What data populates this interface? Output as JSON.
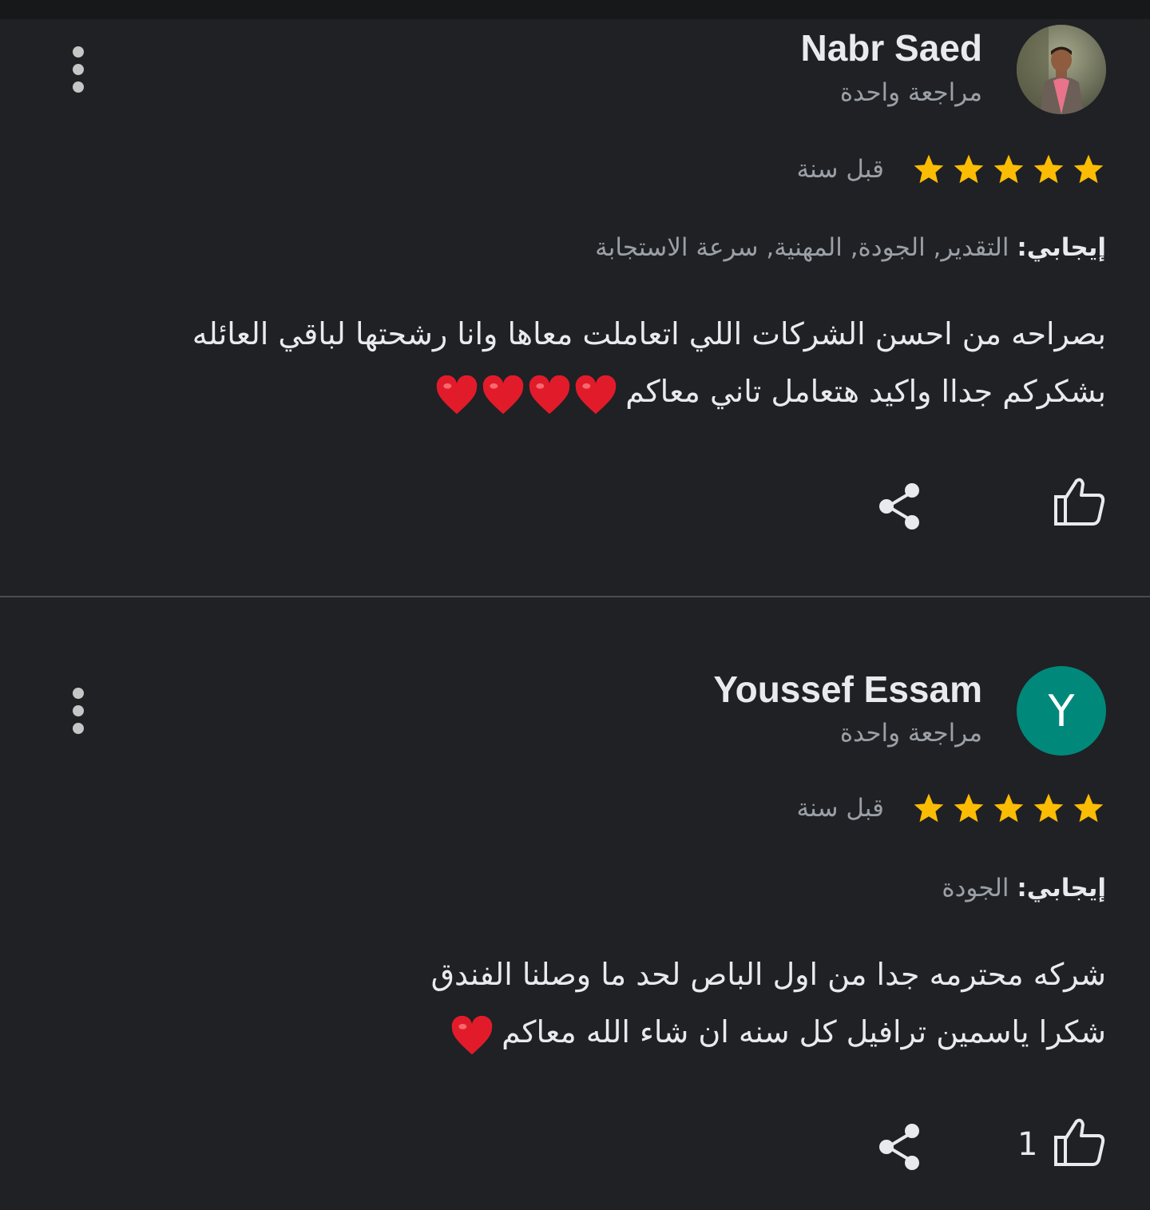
{
  "colors": {
    "background": "#202124",
    "star": "#fbbc04",
    "heart": "#e21b2b",
    "avatar_y": "#00897b"
  },
  "reviews": [
    {
      "name": "Nabr Saed",
      "review_count": "مراجعة واحدة",
      "rating": 5,
      "time": "قبل سنة",
      "attributes_label": "إيجابي:",
      "attributes_value": " التقدير, الجودة, المهنية, سرعة الاستجابة",
      "body_line_1": "بصراحه من احسن الشركات اللي اتعاملت معاها وانا رشحتها لباقي العائله",
      "body_line_2": "بشكركم جداا واكيد هتعامل تاني معاكم",
      "hearts": 4,
      "avatar": "photo",
      "like_count": ""
    },
    {
      "name": "Youssef Essam",
      "review_count": "مراجعة واحدة",
      "rating": 5,
      "time": "قبل سنة",
      "attributes_label": "إيجابي:",
      "attributes_value": " الجودة",
      "body_line_1": "شركه محترمه جدا من اول الباص لحد ما وصلنا الفندق",
      "body_line_2": "شكرا ياسمين ترافيل كل سنه ان شاء الله معاكم",
      "hearts": 1,
      "avatar_letter": "Y",
      "like_count": "1"
    }
  ],
  "icons": {
    "more": "more-vert-icon",
    "share": "share-icon",
    "like": "thumb-up-icon",
    "star": "star-icon",
    "heart": "heart-emoji-icon"
  }
}
